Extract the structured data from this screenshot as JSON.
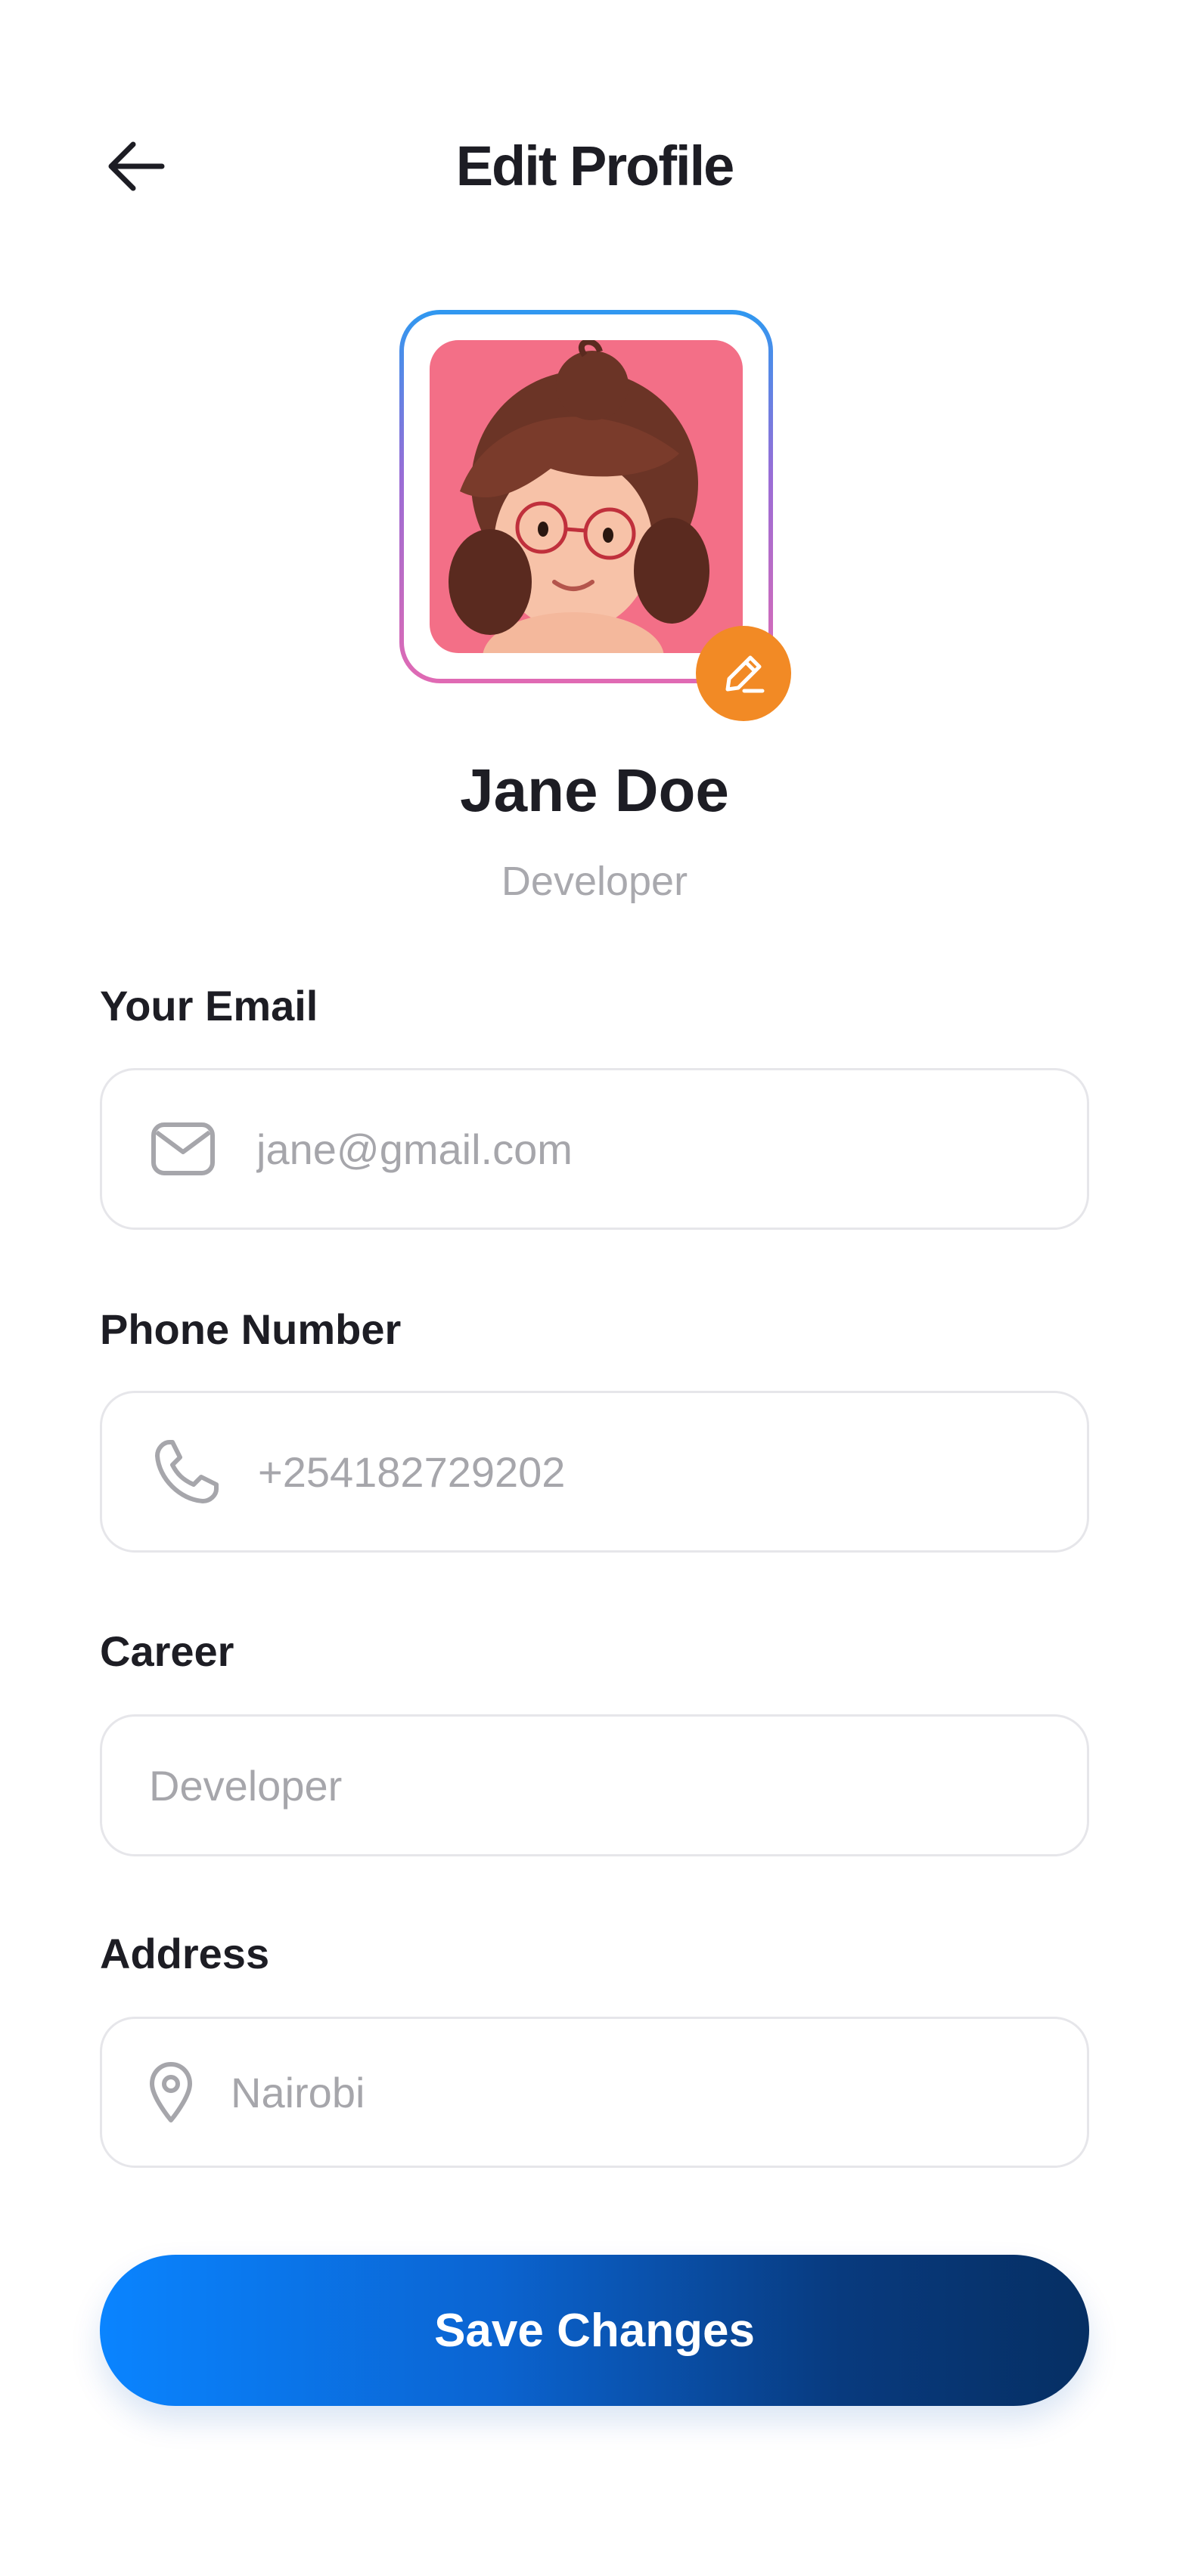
{
  "header": {
    "title": "Edit Profile",
    "back_icon": "arrow-left-icon"
  },
  "profile": {
    "name": "Jane Doe",
    "role": "Developer",
    "avatar_bg": "#f36f87",
    "edit_icon": "pencil-icon",
    "edit_badge_color": "#f28a25"
  },
  "form": {
    "email": {
      "label": "Your Email",
      "value": "jane@gmail.com",
      "icon": "envelope-icon"
    },
    "phone": {
      "label": "Phone Number",
      "value": "+254182729202",
      "icon": "phone-icon"
    },
    "career": {
      "label": "Career",
      "value": "Developer"
    },
    "address": {
      "label": "Address",
      "value": "Nairobi",
      "icon": "map-pin-icon"
    }
  },
  "actions": {
    "save_label": "Save Changes"
  },
  "colors": {
    "accent_start": "#0a84ff",
    "accent_end": "#062f63",
    "muted_text": "#a6a6ab",
    "border": "#e6e6ea"
  }
}
